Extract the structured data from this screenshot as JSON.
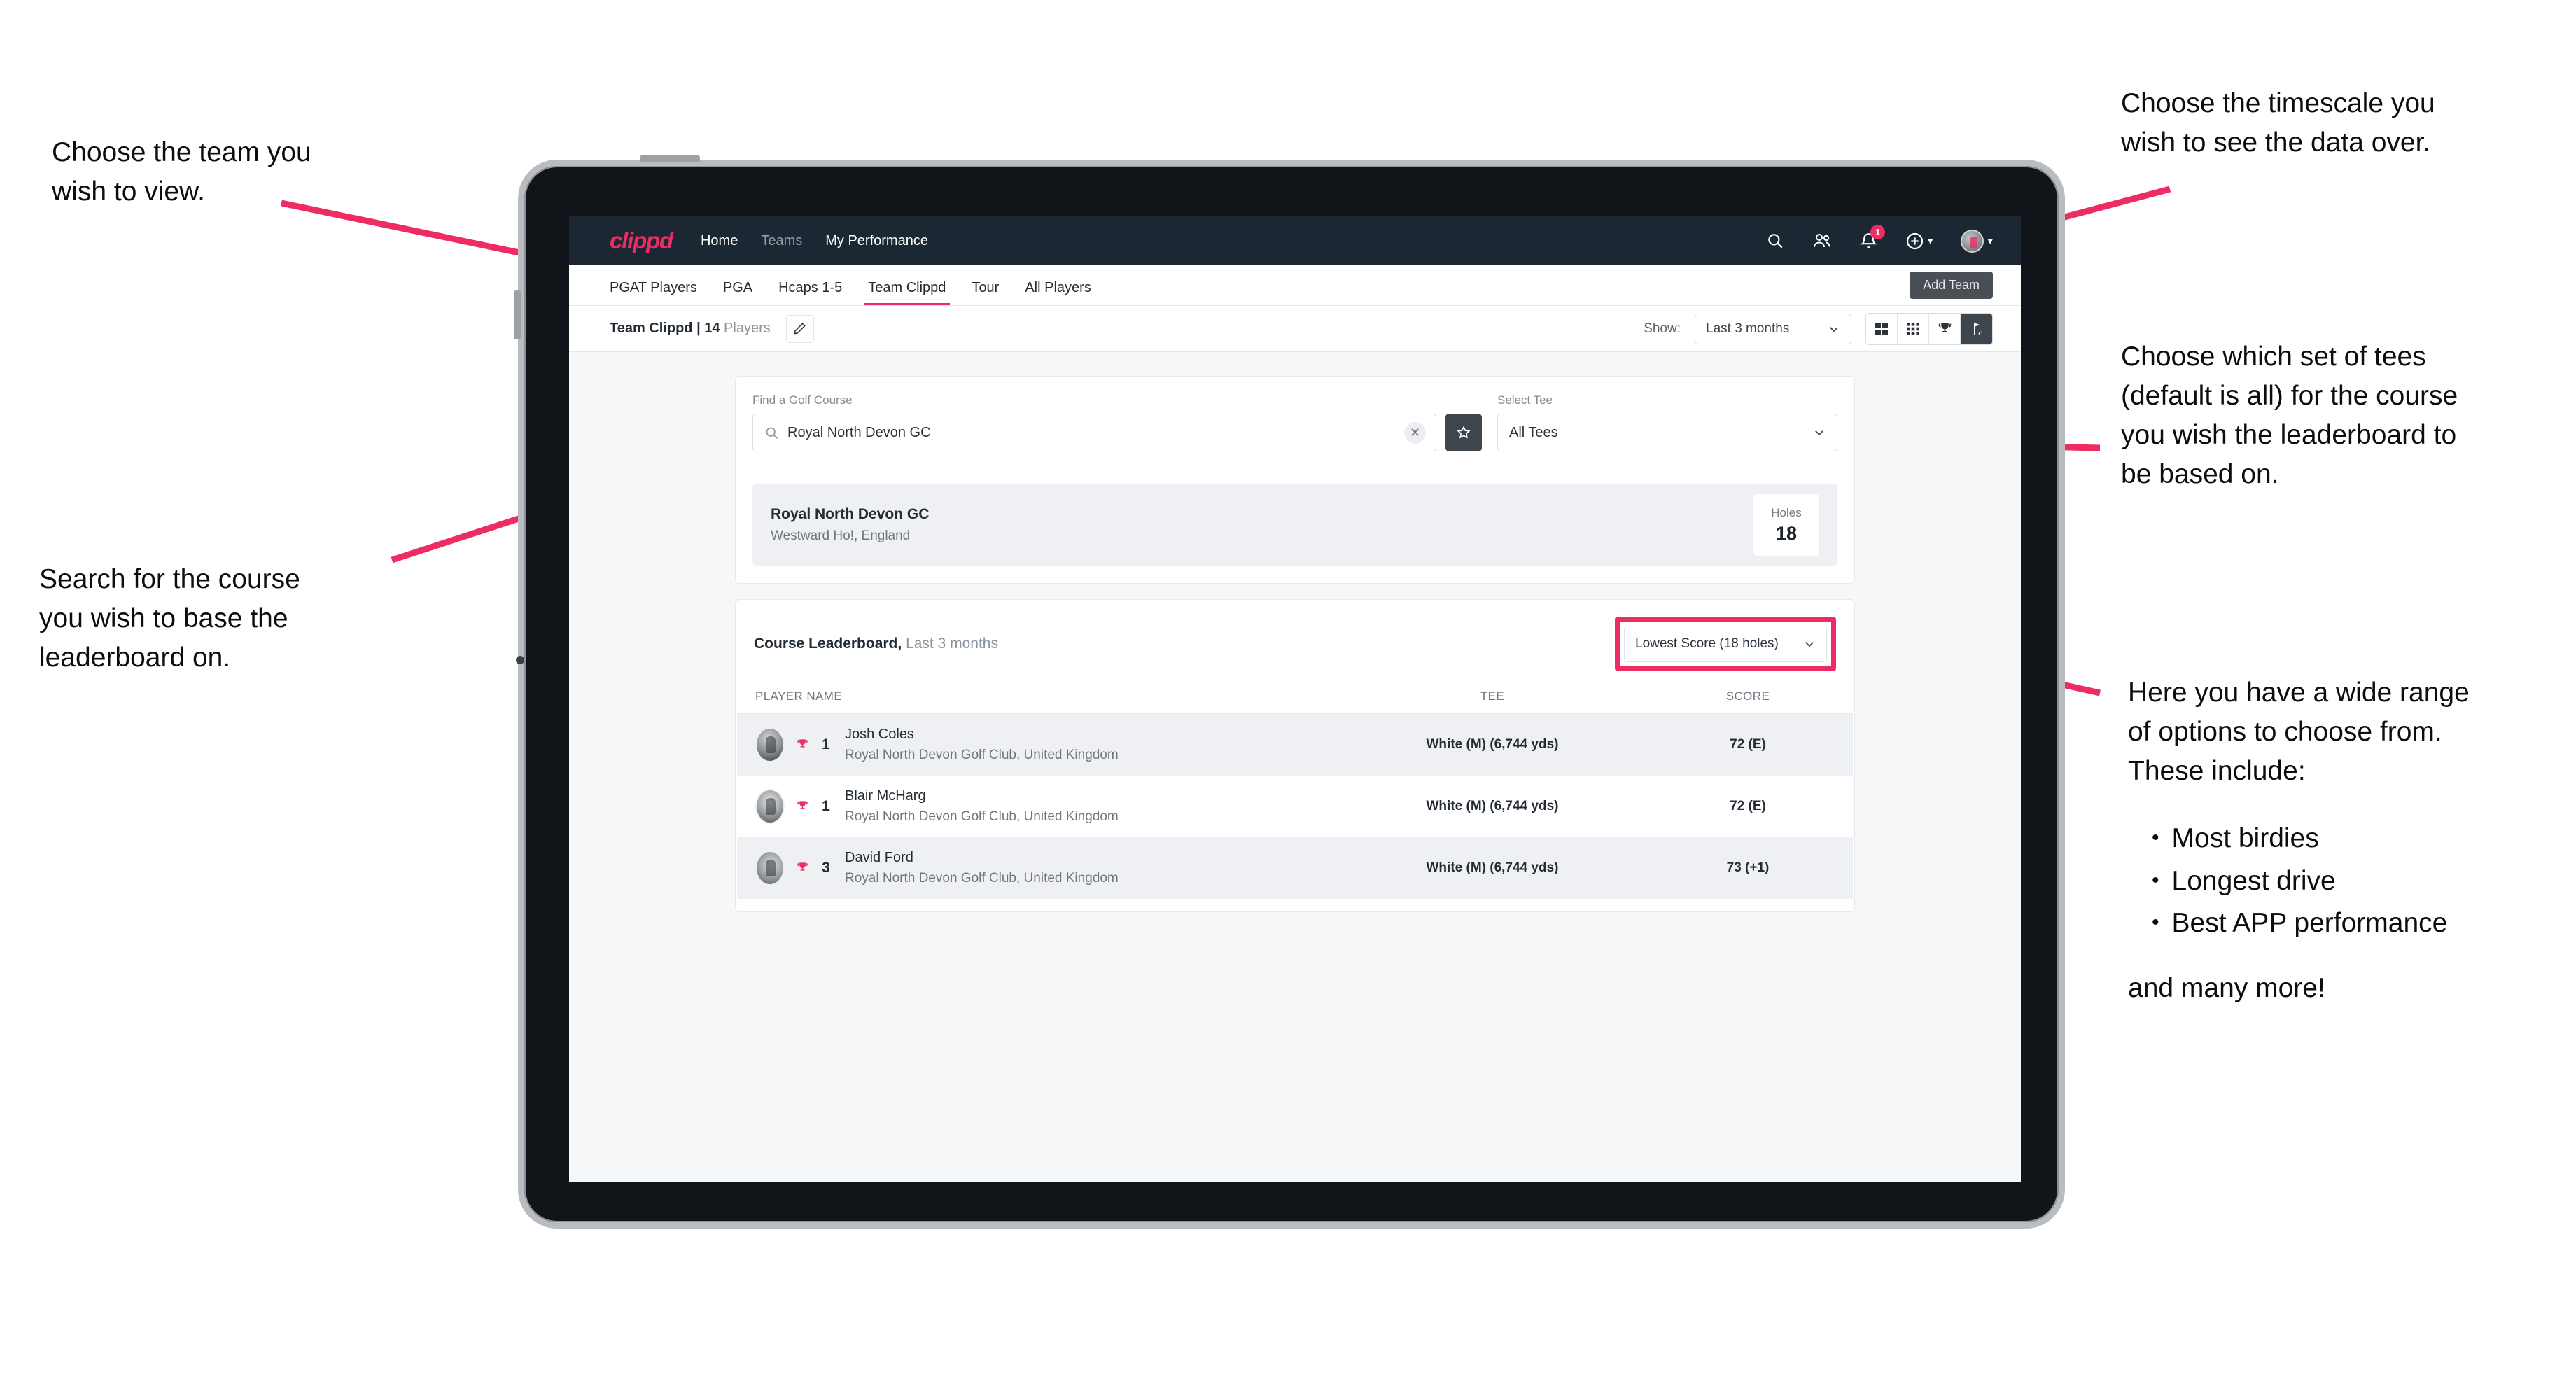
{
  "annotations": {
    "team": "Choose the team you\nwish to view.",
    "timescale": "Choose the timescale you\nwish to see the data over.",
    "tees": "Choose which set of tees\n(default is all) for the course\nyou wish the leaderboard to\nbe based on.",
    "search": "Search for the course\nyou wish to base the\nleaderboard on.",
    "options_intro": "Here you have a wide range\nof options to choose from.\nThese include:",
    "options_list": [
      "Most birdies",
      "Longest drive",
      "Best APP performance"
    ],
    "options_outro": "and many more!",
    "accent": "#ec2c62"
  },
  "app": {
    "brand": "clippd",
    "nav": [
      {
        "label": "Home",
        "active": true
      },
      {
        "label": "Teams",
        "active": false
      },
      {
        "label": "My Performance",
        "active": true
      }
    ],
    "nav_icons": {
      "search": "search-icon",
      "people": "people-icon",
      "notifications": "bell-icon",
      "notification_count": "1",
      "add": "plus-circle-icon",
      "profile": "avatar-icon"
    },
    "tabs": [
      {
        "label": "PGAT Players",
        "state": "normal"
      },
      {
        "label": "PGA",
        "state": "normal"
      },
      {
        "label": "Hcaps 1-5",
        "state": "normal"
      },
      {
        "label": "Team Clippd",
        "state": "active"
      },
      {
        "label": "Tour",
        "state": "normal"
      },
      {
        "label": "All Players",
        "state": "normal"
      }
    ],
    "tooltip": "Add Team",
    "toolbar": {
      "team_name": "Team Clippd",
      "separator": " | ",
      "player_count": "14",
      "players_word": " Players",
      "edit_icon": "pencil-icon",
      "show_label": "Show:",
      "show_value": "Last 3 months",
      "views": [
        {
          "icon": "grid-2x2-icon",
          "selected": false
        },
        {
          "icon": "grid-3x3-icon",
          "selected": false
        },
        {
          "icon": "trophy-icon",
          "selected": false
        },
        {
          "icon": "golf-flag-icon",
          "selected": true
        }
      ]
    },
    "search_card": {
      "course_label": "Find a Golf Course",
      "course_value": "Royal North Devon GC",
      "course_placeholder": "Find a Golf Course",
      "clear_icon": "close-icon",
      "star_icon": "star-icon",
      "tee_label": "Select Tee",
      "tee_value": "All Tees"
    },
    "course_result": {
      "name": "Royal North Devon GC",
      "location": "Westward Ho!, England",
      "holes_label": "Holes",
      "holes_value": "18"
    },
    "leaderboard": {
      "title": "Course Leaderboard,",
      "subtitle": " Last 3 months",
      "sort_value": "Lowest Score (18 holes)",
      "columns": [
        "PLAYER NAME",
        "TEE",
        "SCORE"
      ],
      "rows": [
        {
          "rank": "1",
          "name": "Josh Coles",
          "club": "Royal North Devon Golf Club, United Kingdom",
          "tee": "White (M) (6,744 yds)",
          "score": "72 (E)"
        },
        {
          "rank": "1",
          "name": "Blair McHarg",
          "club": "Royal North Devon Golf Club, United Kingdom",
          "tee": "White (M) (6,744 yds)",
          "score": "72 (E)"
        },
        {
          "rank": "3",
          "name": "David Ford",
          "club": "Royal North Devon Golf Club, United Kingdom",
          "tee": "White (M) (6,744 yds)",
          "score": "73 (+1)"
        }
      ]
    }
  }
}
